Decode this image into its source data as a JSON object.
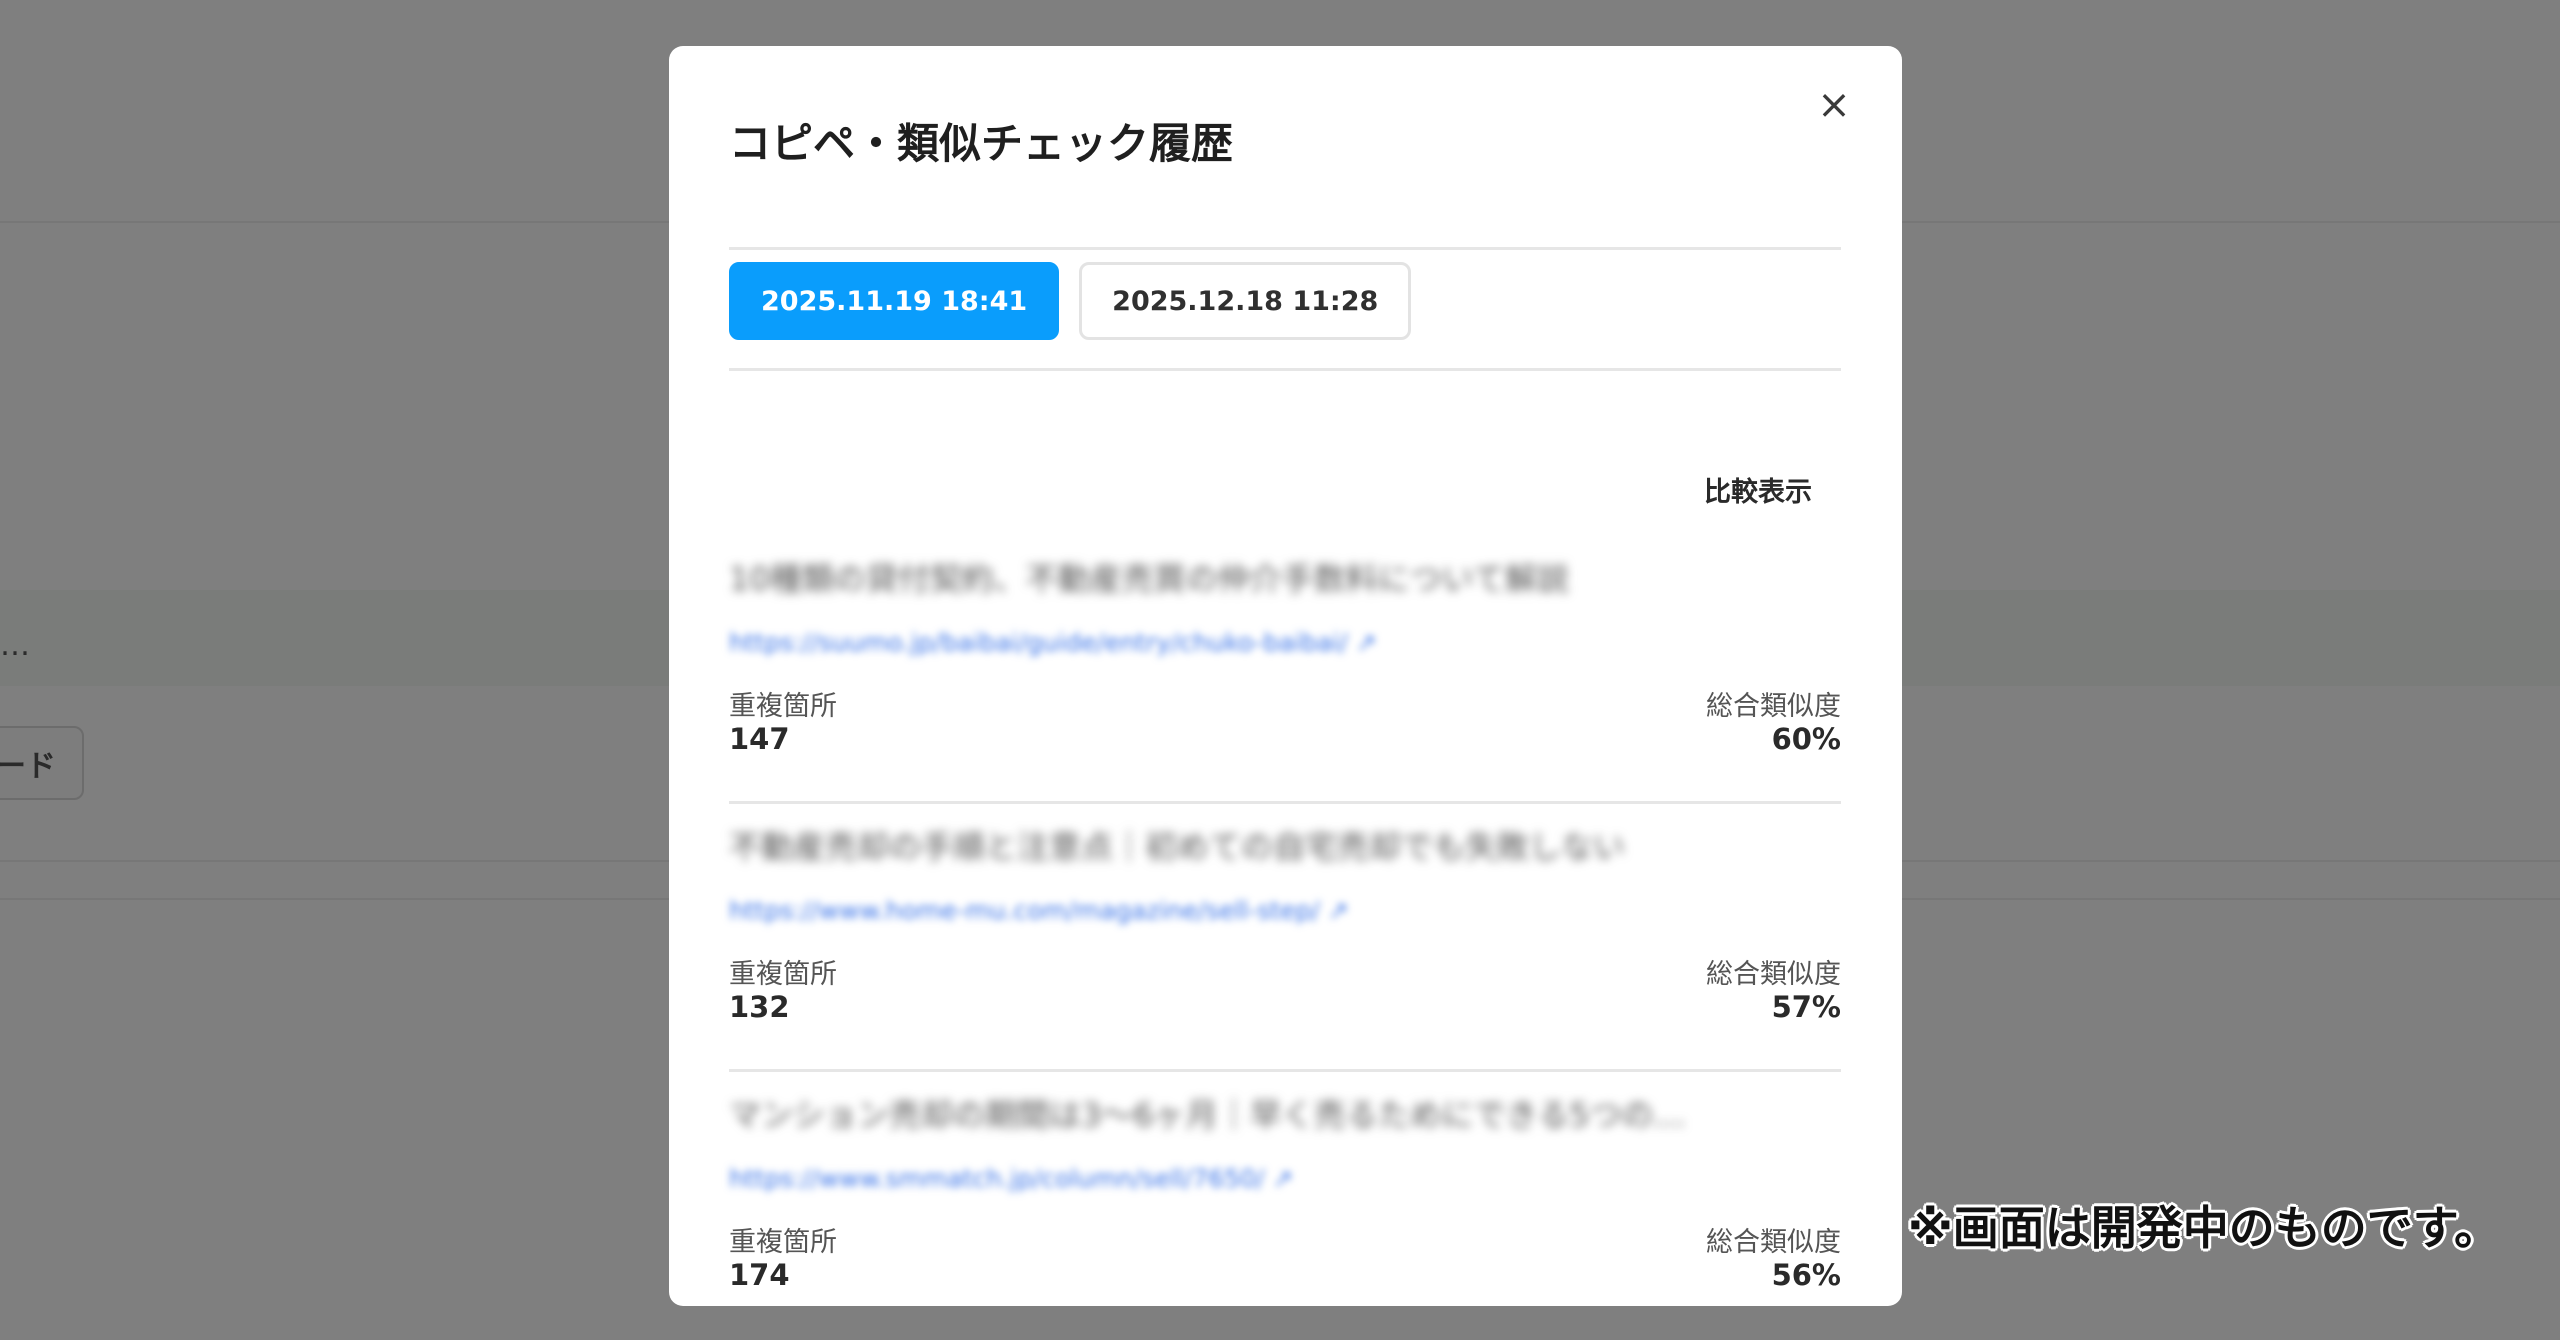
{
  "background": {
    "ellipsis": "…",
    "button_label": "ード"
  },
  "modal": {
    "title": "コピペ・類似チェック履歴",
    "close_icon": "×",
    "tabs": [
      {
        "label": "2025.11.19 18:41",
        "active": true
      },
      {
        "label": "2025.12.18 11:28",
        "active": false
      }
    ],
    "compare_label": "比較表示",
    "results": [
      {
        "title": "10種類の貸付契約、不動産売買の仲介手数料について解説",
        "url": "https://suumo.jp/baibai/guide/entry/chuko-baibai/ ↗",
        "dup_label": "重複箇所",
        "dup_value": "147",
        "sim_label": "総合類似度",
        "sim_value": "60%"
      },
      {
        "title": "不動産売却の手順と注意点｜初めての自宅売却でも失敗しない",
        "url": "https://www.home-mu.com/magazine/sell-step/ ↗",
        "dup_label": "重複箇所",
        "dup_value": "132",
        "sim_label": "総合類似度",
        "sim_value": "57%"
      },
      {
        "title": "マンション売却の期間は3〜6ヶ月｜早く売るためにできる5つの…",
        "url": "https://www.smmatch.jp/column/sell/7650/ ↗",
        "dup_label": "重複箇所",
        "dup_value": "174",
        "sim_label": "総合類似度",
        "sim_value": "56%"
      }
    ]
  },
  "caption": "※画面は開発中のものです。"
}
